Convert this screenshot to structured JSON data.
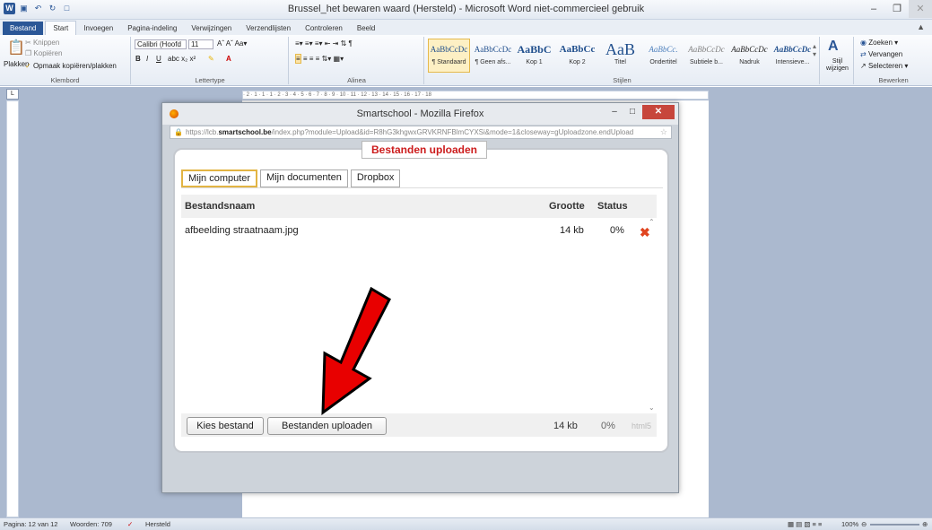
{
  "word": {
    "title": "Brussel_het bewaren waard (Hersteld) - Microsoft Word niet-commercieel gebruik",
    "tabs": [
      "Bestand",
      "Start",
      "Invoegen",
      "Pagina-indeling",
      "Verwijzingen",
      "Verzendlijsten",
      "Controleren",
      "Beeld"
    ],
    "clipboard": {
      "paste": "Plakken",
      "cut": "Knippen",
      "copy": "Kopiëren",
      "format_painter": "Opmaak kopiëren/plakken",
      "label": "Klembord"
    },
    "font": {
      "name": "Calibri (Hoofd",
      "size": "11",
      "label": "Lettertype"
    },
    "paragraph_label": "Alinea",
    "styles": [
      {
        "sample": "AaBbCcDc",
        "name": "¶ Standaard"
      },
      {
        "sample": "AaBbCcDc",
        "name": "¶ Geen afs..."
      },
      {
        "sample": "AaBbC",
        "name": "Kop 1"
      },
      {
        "sample": "AaBbCc",
        "name": "Kop 2"
      },
      {
        "sample": "AaB",
        "name": "Titel"
      },
      {
        "sample": "AaBbCc.",
        "name": "Ondertitel"
      },
      {
        "sample": "AaBbCcDc",
        "name": "Subtiele b..."
      },
      {
        "sample": "AaBbCcDc",
        "name": "Nadruk"
      },
      {
        "sample": "AaBbCcDc",
        "name": "Intensieve..."
      }
    ],
    "styles_label": "Stijlen",
    "change_styles": "Stijl wijzigen",
    "editing": {
      "find": "Zoeken",
      "replace": "Vervangen",
      "select": "Selecteren",
      "label": "Bewerken"
    },
    "status": {
      "page": "Pagina: 12 van 12",
      "words": "Woorden: 709",
      "recovered": "Hersteld",
      "zoom": "100%"
    }
  },
  "firefox": {
    "title": "Smartschool - Mozilla Firefox",
    "url_prefix": "https://lcb.",
    "url_domain": "smartschool.be",
    "url_rest": "/index.php?module=Upload&id=R8hG3khgwxGRVKRNFBlmCYXSi&mode=1&closeway=gUploadzone.endUpload"
  },
  "upload": {
    "header": "Bestanden uploaden",
    "tabs": [
      "Mijn computer",
      "Mijn documenten",
      "Dropbox"
    ],
    "columns": {
      "name": "Bestandsnaam",
      "size": "Grootte",
      "status": "Status"
    },
    "files": [
      {
        "name": "afbeelding straatnaam.jpg",
        "size": "14 kb",
        "status": "0%"
      }
    ],
    "choose_button": "Kies bestand",
    "upload_button": "Bestanden uploaden",
    "total_size": "14 kb",
    "total_status": "0%",
    "html5": "html5"
  }
}
